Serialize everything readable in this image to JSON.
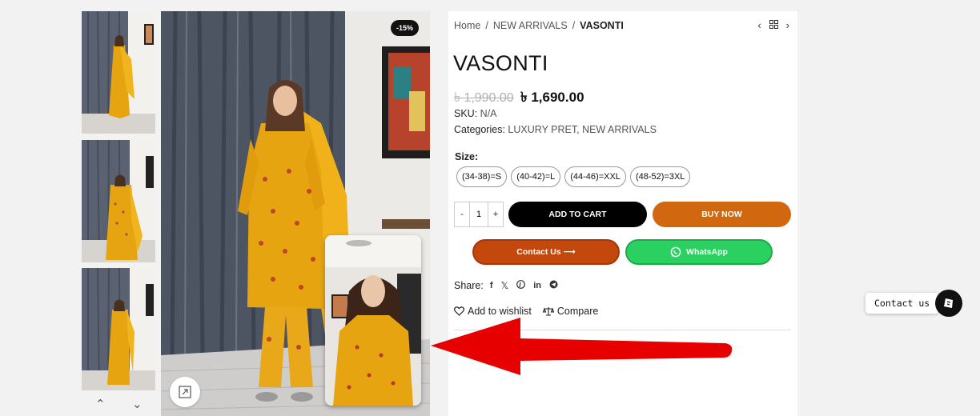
{
  "breadcrumb": {
    "home": "Home",
    "category": "NEW ARRIVALS",
    "current": "VASONTI"
  },
  "product": {
    "title": "VASONTI",
    "old_price": "৳ 1,990.00",
    "new_price": "৳ 1,690.00",
    "discount_badge": "-15%",
    "sku_label": "SKU:",
    "sku_value": "N/A",
    "categories_label": "Categories:",
    "categories": [
      "LUXURY PRET",
      "NEW ARRIVALS"
    ],
    "categories_sep": ", "
  },
  "size": {
    "label": "Size",
    "options": [
      "(34-38)=S",
      "(40-42)=L",
      "(44-46)=XXL",
      "(48-52)=3XL"
    ]
  },
  "cart": {
    "qty": "1",
    "minus": "-",
    "plus": "+",
    "add_to_cart": "ADD TO CART",
    "buy_now": "BUY NOW",
    "contact_us": "Contact Us ⟶",
    "whatsapp": "WhatsApp"
  },
  "share": {
    "label": "Share:",
    "icons": [
      "facebook-icon",
      "x-icon",
      "pinterest-icon",
      "linkedin-icon",
      "telegram-icon"
    ]
  },
  "actions": {
    "wishlist": "Add to wishlist",
    "compare": "Compare"
  },
  "floating": {
    "contact_label": "Contact us"
  },
  "colors": {
    "accent_orange": "#d1680f",
    "contact_button": "#c4470b",
    "whatsapp_green": "#2bd160",
    "cart_black": "#000000",
    "arrow_red": "#e60000",
    "dress_yellow": "#e6a411"
  }
}
